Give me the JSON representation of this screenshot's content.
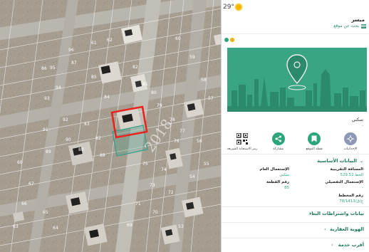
{
  "weather": {
    "temperature": "29°",
    "icon": "sun-icon"
  },
  "header": {
    "app_title": "ميسر",
    "search_placeholder": "بحث عن موقع",
    "menu_icon": "hamburger-icon"
  },
  "map": {
    "parcel_labels": [
      "96",
      "95",
      "94",
      "93",
      "92",
      "91",
      "90",
      "89",
      "88",
      "88",
      "87",
      "86",
      "85",
      "84",
      "83",
      "82",
      "82",
      "81",
      "80",
      "79",
      "78",
      "77",
      "76",
      "75",
      "74",
      "73",
      "72",
      "71",
      "70",
      "69",
      "68",
      "67",
      "66",
      "65",
      "64",
      "63",
      "62",
      "61",
      "60",
      "59",
      "58",
      "57",
      "56",
      "55",
      "54",
      "53"
    ],
    "watermark": "2018",
    "selected_parcel": "85",
    "highlight_color": "#e8241e",
    "adjacent_color": "#38a08a"
  },
  "card": {
    "category": "سكني",
    "category_dash": "-",
    "actions": [
      {
        "label": "الإحداثيات",
        "icon": "coordinates-icon"
      },
      {
        "label": "نقطة الموقع",
        "icon": "bookmark-icon"
      },
      {
        "label": "مشاركة",
        "icon": "share-icon"
      },
      {
        "label": "رمز الاستجابة السريعة",
        "icon": "qr-code-icon"
      }
    ]
  },
  "basic_info": {
    "title": "البيانات الأساسية",
    "fields": {
      "district_label": "المسافة التقريبية",
      "district_value": "الخط 529.52",
      "planned_use_label": "الإستعمال التفصيلي",
      "planned_use_value": "-",
      "general_use_label": "الإستعمال العام",
      "general_use_value": "سكني",
      "parcel_no_label": "رقم القطعة",
      "parcel_no_value": "85",
      "plan_no_label": "رقم المخطط",
      "plan_no_value": "78/1413/ج/ق"
    }
  },
  "sections": [
    {
      "title": "بيانات واشتراطات البناء",
      "chevron": "‹"
    },
    {
      "title": "الهوية العقارية",
      "chevron": "‹"
    },
    {
      "title": "أقرب خدمة",
      "chevron": "‹"
    }
  ],
  "colors": {
    "accent": "#2da57b",
    "accent_dark": "#1e7a5c",
    "hero_bg": "#3aa584"
  }
}
